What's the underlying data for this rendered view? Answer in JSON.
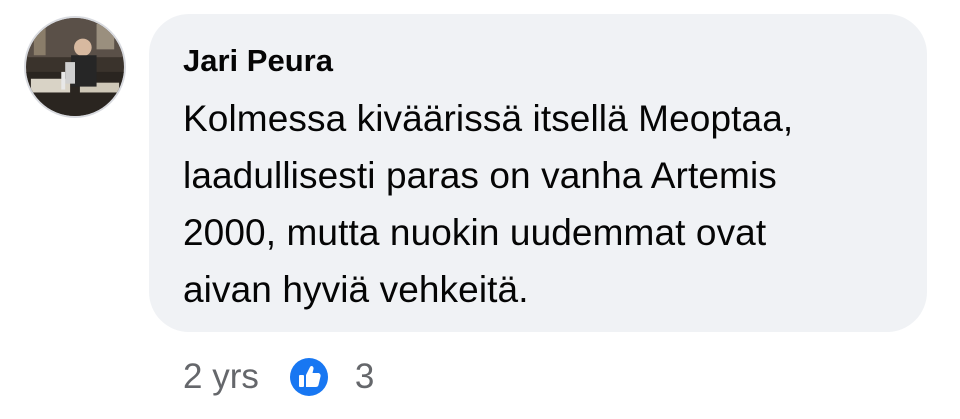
{
  "comment": {
    "author": "Jari Peura",
    "lines": [
      "Kolmessa kivääri­ssä itsellä Meoptaa,",
      "laadullisesti paras on vanha Artemis",
      "2000, mutta nuokin uudemmat ovat",
      "aivan hyviä vehkeitä."
    ],
    "time": "2 yrs",
    "reaction_icon": "like-icon",
    "reaction_count": "3",
    "colors": {
      "bubble": "#f0f2f5",
      "text": "#050505",
      "meta": "#65676b",
      "like": "#1877f2"
    }
  }
}
